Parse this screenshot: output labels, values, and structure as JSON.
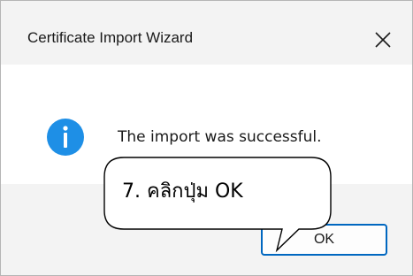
{
  "window": {
    "title": "Certificate Import Wizard",
    "close_icon": "close-icon"
  },
  "message": {
    "icon": "info-icon",
    "text": "The import was successful."
  },
  "buttons": {
    "ok_label": "OK"
  },
  "annotation": {
    "text": "7. คลิกปุ่ม OK"
  },
  "colors": {
    "accent": "#0067c0",
    "info_icon": "#1e8fe6",
    "titlebar_bg": "#f3f3f3"
  }
}
